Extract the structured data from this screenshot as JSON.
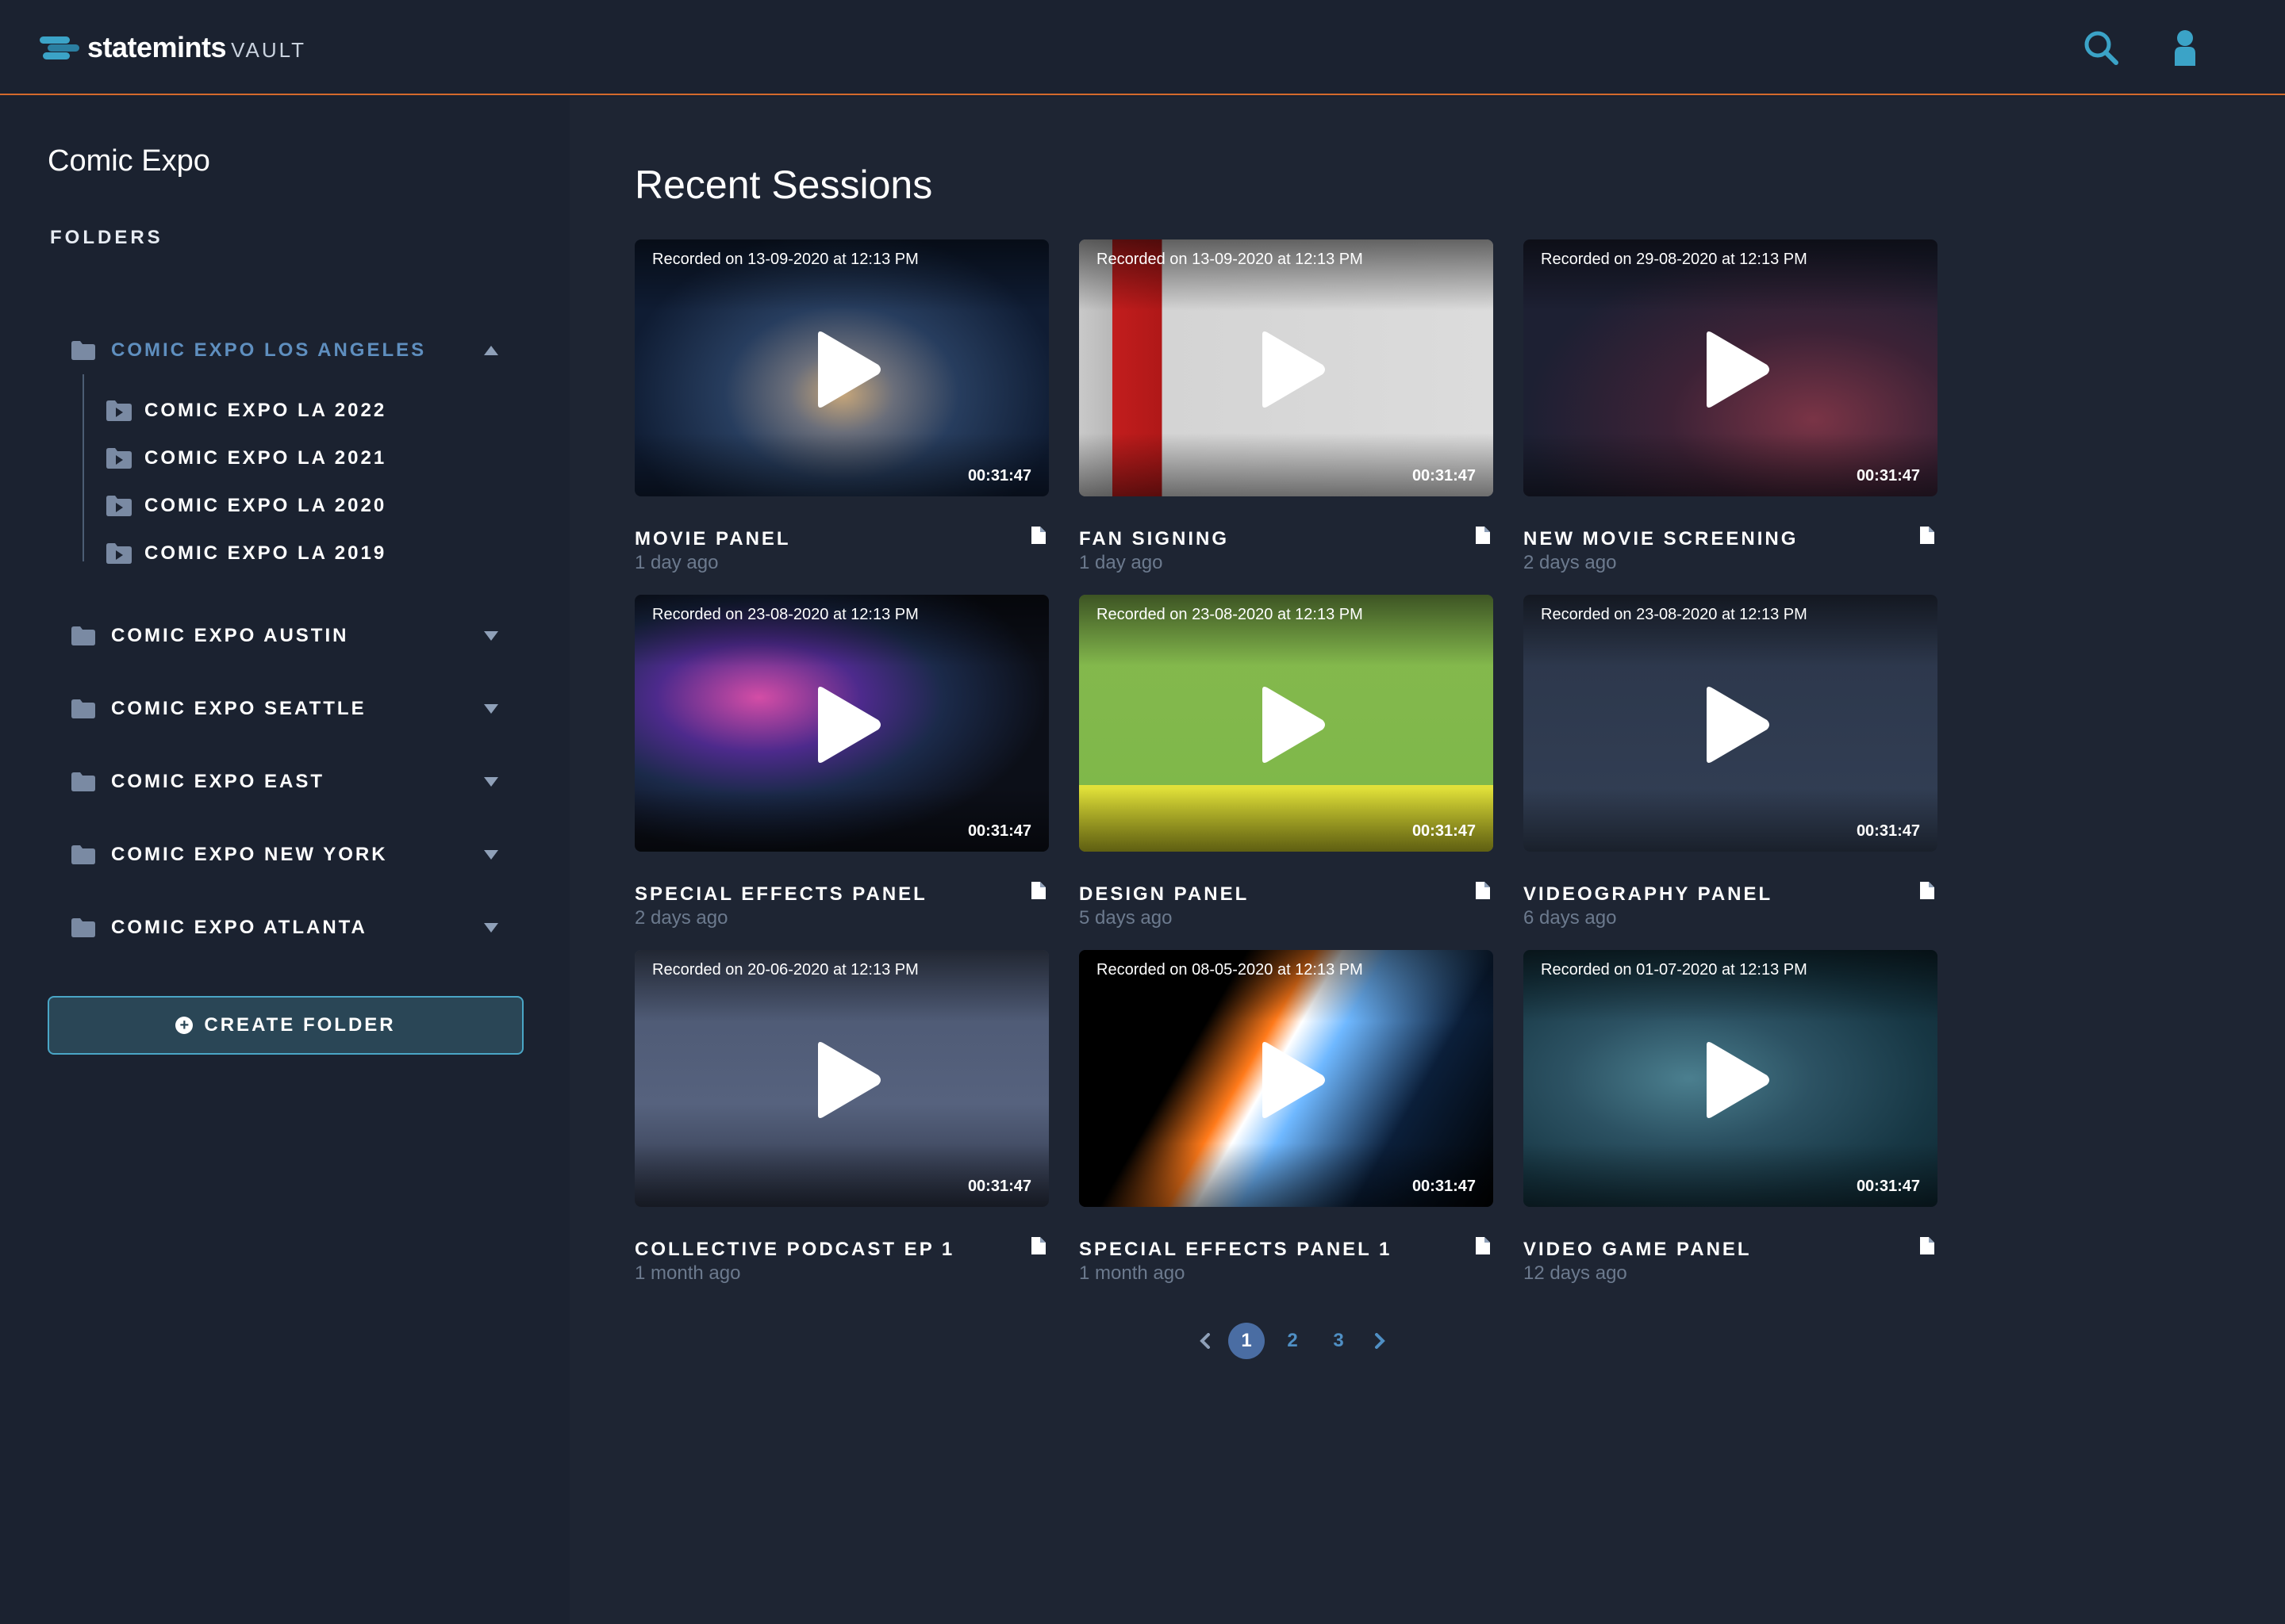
{
  "app": {
    "brand": "statemints",
    "brand_sub": "VAULT"
  },
  "header": {
    "search_icon": "search-icon",
    "user_icon": "user-icon"
  },
  "colors": {
    "accent": "#d46a2c",
    "link": "#4f8fc4",
    "active_folder": "#5f8fbf",
    "button_border": "#4aa6c6"
  },
  "sidebar": {
    "title": "Comic Expo",
    "folders_label": "FOLDERS",
    "folders": [
      {
        "label": "COMIC EXPO LOS ANGELES",
        "expanded": true,
        "children": [
          {
            "label": "COMIC EXPO LA 2022"
          },
          {
            "label": "COMIC EXPO LA 2021"
          },
          {
            "label": "COMIC EXPO LA 2020"
          },
          {
            "label": "COMIC EXPO LA 2019"
          }
        ]
      },
      {
        "label": "COMIC EXPO AUSTIN",
        "expanded": false
      },
      {
        "label": "COMIC EXPO SEATTLE",
        "expanded": false
      },
      {
        "label": "COMIC EXPO EAST",
        "expanded": false
      },
      {
        "label": "COMIC EXPO NEW YORK",
        "expanded": false
      },
      {
        "label": "COMIC EXPO ATLANTA",
        "expanded": false
      }
    ],
    "create_button": "CREATE FOLDER"
  },
  "main": {
    "title": "Recent Sessions",
    "sessions": [
      {
        "recorded": "Recorded on 13-09-2020 at 12:13 PM",
        "duration": "00:31:47",
        "title": "MOVIE PANEL",
        "ago": "1 day ago"
      },
      {
        "recorded": "Recorded on 13-09-2020 at 12:13 PM",
        "duration": "00:31:47",
        "title": "FAN SIGNING",
        "ago": "1 day ago"
      },
      {
        "recorded": "Recorded on 29-08-2020 at 12:13 PM",
        "duration": "00:31:47",
        "title": "NEW MOVIE SCREENING",
        "ago": "2 days ago"
      },
      {
        "recorded": "Recorded on 23-08-2020 at 12:13 PM",
        "duration": "00:31:47",
        "title": "SPECIAL EFFECTS PANEL",
        "ago": "2 days ago"
      },
      {
        "recorded": "Recorded on 23-08-2020 at 12:13 PM",
        "duration": "00:31:47",
        "title": "DESIGN PANEL",
        "ago": "5 days ago"
      },
      {
        "recorded": "Recorded on 23-08-2020 at 12:13 PM",
        "duration": "00:31:47",
        "title": "VIDEOGRAPHY PANEL",
        "ago": "6 days ago"
      },
      {
        "recorded": "Recorded on 20-06-2020 at 12:13 PM",
        "duration": "00:31:47",
        "title": "COLLECTIVE PODCAST EP 1",
        "ago": "1 month ago"
      },
      {
        "recorded": "Recorded on 08-05-2020 at 12:13 PM",
        "duration": "00:31:47",
        "title": "SPECIAL EFFECTS PANEL 1",
        "ago": "1 month ago"
      },
      {
        "recorded": "Recorded on 01-07-2020 at 12:13 PM",
        "duration": "00:31:47",
        "title": "VIDEO GAME PANEL",
        "ago": "12 days ago"
      }
    ]
  },
  "pagination": {
    "pages": [
      "1",
      "2",
      "3"
    ],
    "current": "1"
  }
}
